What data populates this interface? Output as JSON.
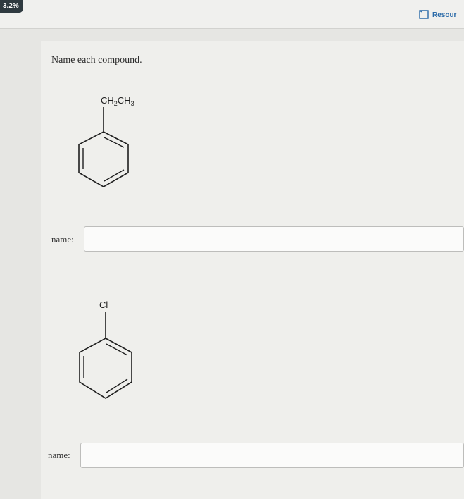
{
  "header": {
    "score": "3.2%",
    "resources_label": "Resour",
    "resources_icon": "bookmark-icon"
  },
  "question": {
    "prompt": "Name each compound."
  },
  "compounds": [
    {
      "substituent": "CH2CH3",
      "substituent_parts": [
        "CH",
        "2",
        "CH",
        "3"
      ],
      "name_label": "name:",
      "answer_value": ""
    },
    {
      "substituent": "Cl",
      "name_label": "name:",
      "answer_value": ""
    }
  ],
  "colors": {
    "link": "#2a6aa8",
    "badge": "#2f3a40"
  }
}
